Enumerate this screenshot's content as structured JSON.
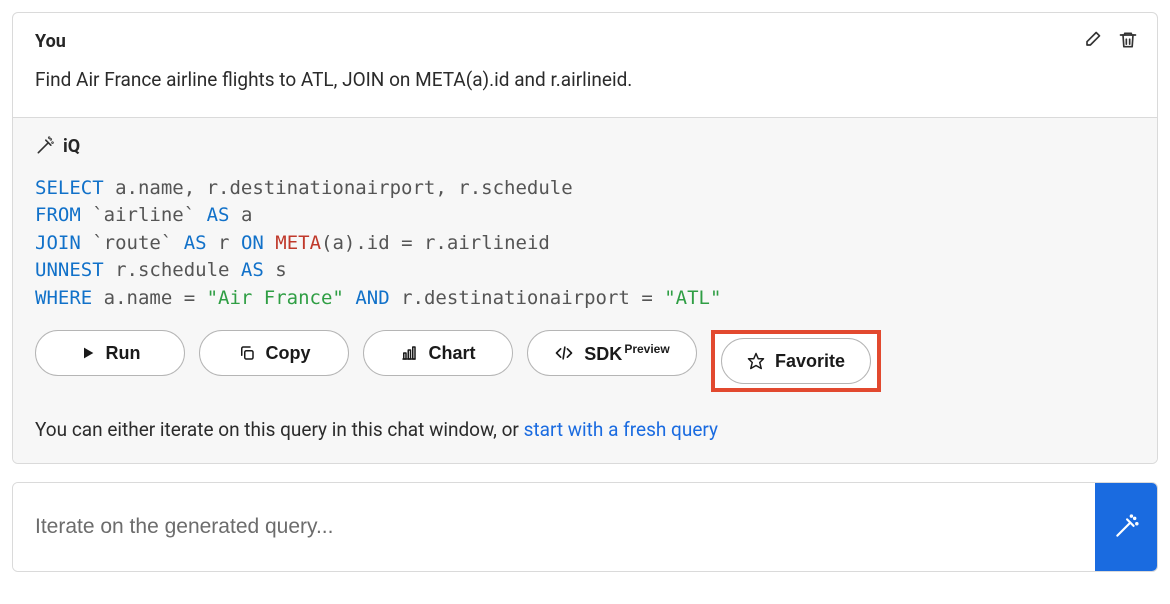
{
  "user": {
    "label": "You",
    "prompt": "Find Air France airline flights to ATL, JOIN on META(a).id and r.airlineid."
  },
  "iq": {
    "label": "iQ",
    "code": {
      "l1": {
        "kw1": "SELECT",
        "rest": " a.name, r.destinationairport, r.schedule"
      },
      "l2": {
        "kw1": "FROM",
        "txt1": " `airline` ",
        "kw2": "AS",
        "txt2": " a"
      },
      "l3": {
        "kw1": "JOIN",
        "txt1": " `route` ",
        "kw2": "AS",
        "txt2": " r ",
        "kw3": "ON",
        "sp": " ",
        "fn": "META",
        "txt3": "(a).id = r.airlineid"
      },
      "l4": {
        "kw1": "UNNEST",
        "txt": " r.schedule ",
        "kw2": "AS",
        "txt2": " s"
      },
      "l5": {
        "kw1": "WHERE",
        "txt1": " a.name = ",
        "str1": "\"Air France\"",
        "sp": " ",
        "kw2": "AND",
        "txt2": " r.destinationairport = ",
        "str2": "\"ATL\""
      }
    },
    "buttons": {
      "run": "Run",
      "copy": "Copy",
      "chart": "Chart",
      "sdk": "SDK",
      "sdk_badge": "Preview",
      "favorite": "Favorite"
    },
    "footer_prefix": "You can either iterate on this query in this chat window, or ",
    "footer_link": "start with a fresh query"
  },
  "input": {
    "placeholder": "Iterate on the generated query..."
  }
}
